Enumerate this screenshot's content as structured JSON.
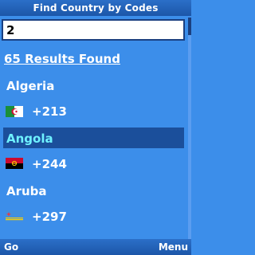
{
  "title": "Find Country by Codes",
  "search": {
    "value": "2"
  },
  "results_text": "65 Results Found",
  "results": [
    {
      "name": "Algeria",
      "code": "+213",
      "flag_icon": "algeria-flag-icon",
      "selected": false
    },
    {
      "name": "Angola",
      "code": "+244",
      "flag_icon": "angola-flag-icon",
      "selected": true
    },
    {
      "name": "Aruba",
      "code": "+297",
      "flag_icon": "aruba-flag-icon",
      "selected": false
    }
  ],
  "softkeys": {
    "left": "Go",
    "right": "Menu"
  },
  "colors": {
    "background": "#3c8eea",
    "bar": "#1c56a8",
    "highlight": "#1b4f9b",
    "selected_text": "#6ff2ff"
  }
}
